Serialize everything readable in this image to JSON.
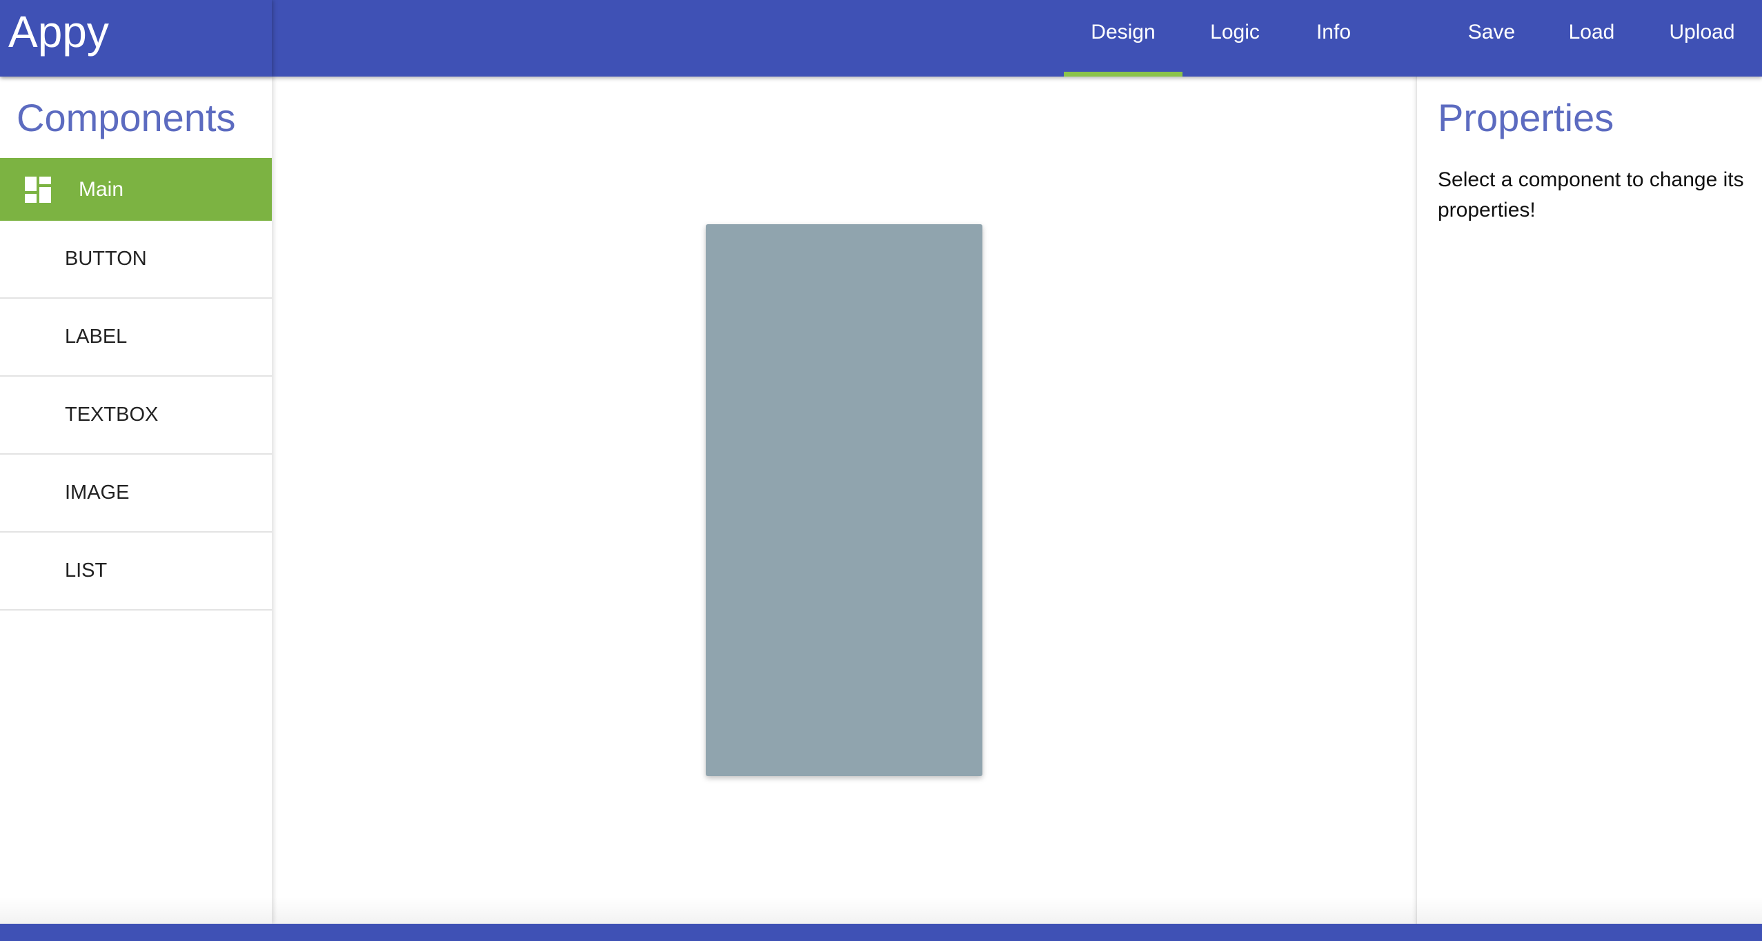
{
  "app": {
    "title": "Appy"
  },
  "nav": {
    "tabs": [
      {
        "label": "Design",
        "active": true
      },
      {
        "label": "Logic",
        "active": false
      },
      {
        "label": "Info",
        "active": false
      }
    ],
    "actions": [
      {
        "label": "Save"
      },
      {
        "label": "Load"
      },
      {
        "label": "Upload"
      }
    ]
  },
  "components_panel": {
    "title": "Components",
    "main_screen": {
      "label": "Main",
      "icon": "dashboard-icon"
    },
    "items": [
      {
        "label": "BUTTON"
      },
      {
        "label": "LABEL"
      },
      {
        "label": "TEXTBOX"
      },
      {
        "label": "IMAGE"
      },
      {
        "label": "LIST"
      }
    ]
  },
  "properties_panel": {
    "title": "Properties",
    "hint": "Select a component to change its properties!"
  },
  "colors": {
    "primary": "#3f51b5",
    "accent": "#8bc34a",
    "selected_item": "#7cb342",
    "heading": "#5c6bc0",
    "phone_canvas": "#90a4ae"
  }
}
